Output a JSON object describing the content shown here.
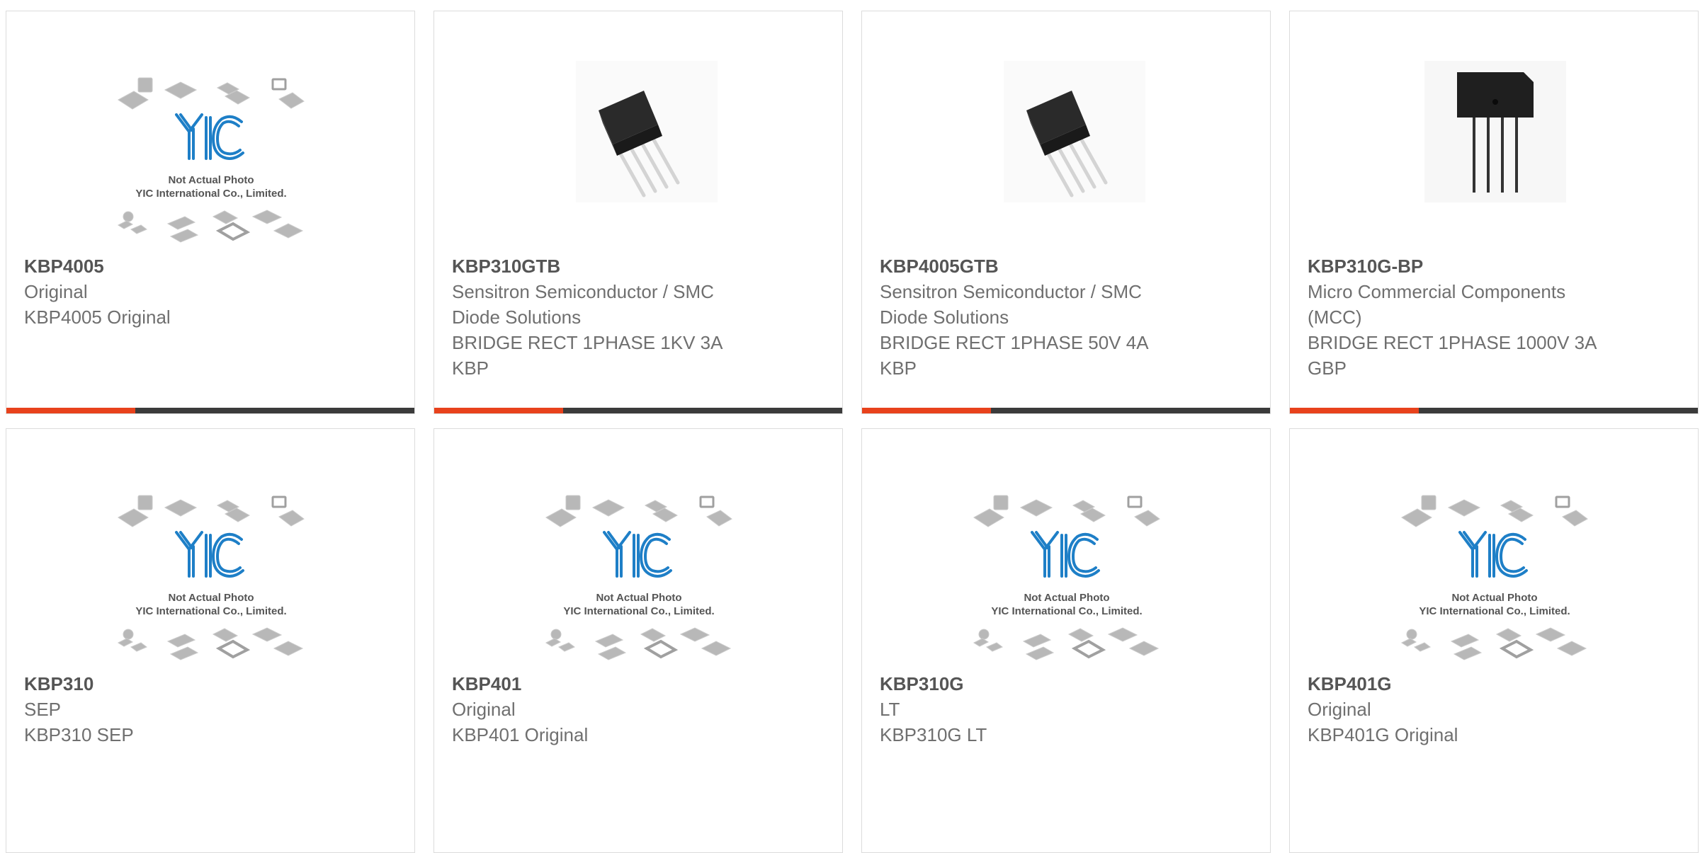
{
  "colors": {
    "accent": "#e8421c",
    "bar": "#3b3b3b",
    "logo_blue": "#1e7fc7",
    "text": "#6f6f6f",
    "title": "#555555"
  },
  "placeholder": {
    "line1": "Not Actual Photo",
    "line2": "YIC International Co., Limited."
  },
  "products": [
    {
      "part": "KBP4005",
      "manufacturer": "Original",
      "description": "KBP4005 Original",
      "image": "placeholder-icon"
    },
    {
      "part": "KBP310GTB",
      "manufacturer": "Sensitron Semiconductor / SMC Diode Solutions",
      "description": "BRIDGE RECT 1PHASE 1KV 3A KBP",
      "image": "bridge-rectifier-angled"
    },
    {
      "part": "KBP4005GTB",
      "manufacturer": "Sensitron Semiconductor / SMC Diode Solutions",
      "description": "BRIDGE RECT 1PHASE 50V 4A KBP",
      "image": "bridge-rectifier-angled"
    },
    {
      "part": "KBP310G-BP",
      "manufacturer": "Micro Commercial Components (MCC)",
      "description": "BRIDGE RECT 1PHASE 1000V 3A GBP",
      "image": "bridge-rectifier-front"
    },
    {
      "part": "KBP310",
      "manufacturer": "SEP",
      "description": "KBP310 SEP",
      "image": "placeholder-icon"
    },
    {
      "part": "KBP401",
      "manufacturer": "Original",
      "description": "KBP401 Original",
      "image": "placeholder-icon"
    },
    {
      "part": "KBP310G",
      "manufacturer": "LT",
      "description": "KBP310G LT",
      "image": "placeholder-icon"
    },
    {
      "part": "KBP401G",
      "manufacturer": "Original",
      "description": "KBP401G Original",
      "image": "placeholder-icon"
    }
  ]
}
